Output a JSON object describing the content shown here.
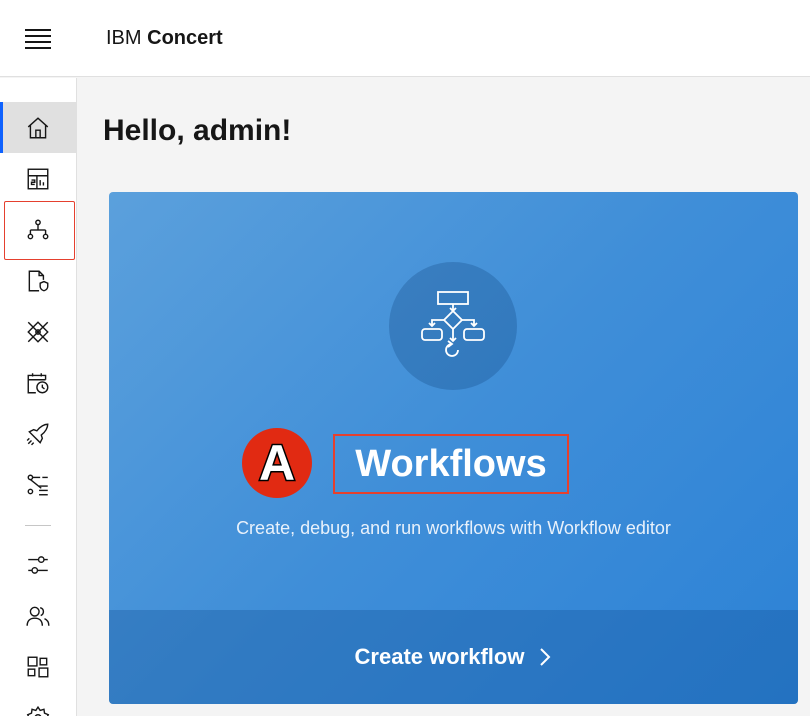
{
  "header": {
    "brand_ibm": "IBM",
    "brand_product": "Concert"
  },
  "sidebar": {
    "items": [
      {
        "name": "home",
        "icon": "home-icon",
        "active": true
      },
      {
        "name": "dashboard",
        "icon": "dashboard-icon",
        "active": false
      },
      {
        "name": "workflows",
        "icon": "workflow-hierarchy-icon",
        "active": false,
        "highlighted": true
      },
      {
        "name": "compliance",
        "icon": "document-security-icon",
        "active": false
      },
      {
        "name": "vulnerability",
        "icon": "debug-icon",
        "active": false
      },
      {
        "name": "schedule",
        "icon": "event-schedule-icon",
        "active": false
      },
      {
        "name": "deploy",
        "icon": "rocket-icon",
        "active": false
      },
      {
        "name": "data-flow",
        "icon": "flow-list-icon",
        "active": false
      },
      {
        "name": "settings",
        "icon": "sliders-icon",
        "active": false
      },
      {
        "name": "users",
        "icon": "user-multiple-icon",
        "active": false
      },
      {
        "name": "apps",
        "icon": "apps-icon",
        "active": false
      },
      {
        "name": "admin",
        "icon": "gear-icon",
        "active": false
      }
    ],
    "highlight_color": "#e5402e",
    "active_color": "#0f62fe"
  },
  "main": {
    "greeting": "Hello, admin!",
    "card": {
      "icon": "workflow-diagram-icon",
      "title": "Workflows",
      "description": "Create, debug, and run workflows with Workflow editor",
      "action_label": "Create workflow",
      "action_icon": "chevron-right-icon"
    }
  },
  "annotation": {
    "badge_label": "A",
    "badge_color": "#e12a12"
  }
}
